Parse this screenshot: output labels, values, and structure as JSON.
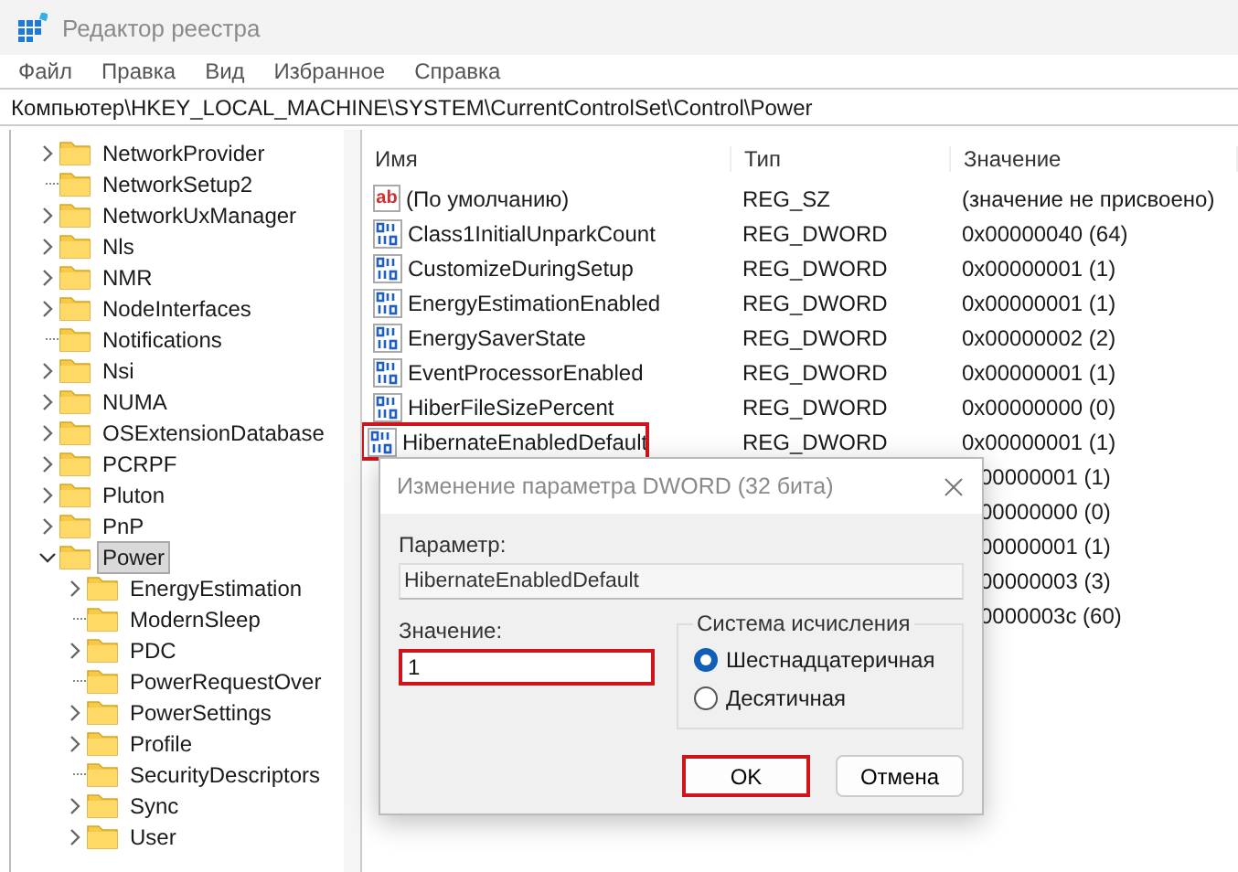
{
  "window": {
    "title": "Редактор реестра"
  },
  "menu": [
    "Файл",
    "Правка",
    "Вид",
    "Избранное",
    "Справка"
  ],
  "address": "Компьютер\\HKEY_LOCAL_MACHINE\\SYSTEM\\CurrentControlSet\\Control\\Power",
  "tree": [
    {
      "label": "NetworkProvider",
      "has_children": true,
      "selected": false
    },
    {
      "label": "NetworkSetup2",
      "has_children": false,
      "selected": false
    },
    {
      "label": "NetworkUxManager",
      "has_children": true,
      "selected": false
    },
    {
      "label": "Nls",
      "has_children": true,
      "selected": false
    },
    {
      "label": "NMR",
      "has_children": true,
      "selected": false
    },
    {
      "label": "NodeInterfaces",
      "has_children": true,
      "selected": false
    },
    {
      "label": "Notifications",
      "has_children": false,
      "selected": false
    },
    {
      "label": "Nsi",
      "has_children": true,
      "selected": false
    },
    {
      "label": "NUMA",
      "has_children": true,
      "selected": false
    },
    {
      "label": "OSExtensionDatabase",
      "has_children": true,
      "selected": false
    },
    {
      "label": "PCRPF",
      "has_children": true,
      "selected": false
    },
    {
      "label": "Pluton",
      "has_children": true,
      "selected": false
    },
    {
      "label": "PnP",
      "has_children": true,
      "selected": false
    },
    {
      "label": "Power",
      "has_children": true,
      "selected": true,
      "children": [
        {
          "label": "EnergyEstimation",
          "has_children": true,
          "selected": false
        },
        {
          "label": "ModernSleep",
          "has_children": false,
          "selected": false
        },
        {
          "label": "PDC",
          "has_children": true,
          "selected": false
        },
        {
          "label": "PowerRequestOver",
          "has_children": false,
          "selected": false
        },
        {
          "label": "PowerSettings",
          "has_children": true,
          "selected": false
        },
        {
          "label": "Profile",
          "has_children": true,
          "selected": false
        },
        {
          "label": "SecurityDescriptors",
          "has_children": false,
          "selected": false
        },
        {
          "label": "Sync",
          "has_children": true,
          "selected": false
        },
        {
          "label": "User",
          "has_children": true,
          "selected": false
        }
      ]
    }
  ],
  "list": {
    "columns": [
      "Имя",
      "Тип",
      "Значение"
    ],
    "rows": [
      {
        "kind": "string",
        "icon_text": "ab",
        "name": "(По умолчанию)",
        "type": "REG_SZ",
        "value": "(значение не присвоено)",
        "highlighted": false
      },
      {
        "kind": "dword",
        "name": "Class1InitialUnparkCount",
        "type": "REG_DWORD",
        "value": "0x00000040 (64)",
        "highlighted": false
      },
      {
        "kind": "dword",
        "name": "CustomizeDuringSetup",
        "type": "REG_DWORD",
        "value": "0x00000001 (1)",
        "highlighted": false
      },
      {
        "kind": "dword",
        "name": "EnergyEstimationEnabled",
        "type": "REG_DWORD",
        "value": "0x00000001 (1)",
        "highlighted": false
      },
      {
        "kind": "dword",
        "name": "EnergySaverState",
        "type": "REG_DWORD",
        "value": "0x00000002 (2)",
        "highlighted": false
      },
      {
        "kind": "dword",
        "name": "EventProcessorEnabled",
        "type": "REG_DWORD",
        "value": "0x00000001 (1)",
        "highlighted": false
      },
      {
        "kind": "dword",
        "name": "HiberFileSizePercent",
        "type": "REG_DWORD",
        "value": "0x00000000 (0)",
        "highlighted": false
      },
      {
        "kind": "dword",
        "name": "HibernateEnabledDefault",
        "type": "REG_DWORD",
        "value": "0x00000001 (1)",
        "highlighted": true
      },
      {
        "kind": "covered",
        "value": "00000001 (1)"
      },
      {
        "kind": "covered",
        "value": "00000000 (0)"
      },
      {
        "kind": "covered",
        "value": "00000001 (1)"
      },
      {
        "kind": "covered",
        "value": "00000003 (3)"
      },
      {
        "kind": "covered",
        "value": "0000003c (60)"
      }
    ]
  },
  "dialog": {
    "title": "Изменение параметра DWORD (32 бита)",
    "param_label": "Параметр:",
    "param_value": "HibernateEnabledDefault",
    "value_label": "Значение:",
    "value": "1",
    "value_highlighted": true,
    "base_group": "Система исчисления",
    "base_options": [
      {
        "label": "Шестнадцатеричная",
        "selected": true
      },
      {
        "label": "Десятичная",
        "selected": false
      }
    ],
    "buttons": [
      {
        "label": "OK",
        "highlighted": true
      },
      {
        "label": "Отмена",
        "highlighted": false
      }
    ]
  }
}
